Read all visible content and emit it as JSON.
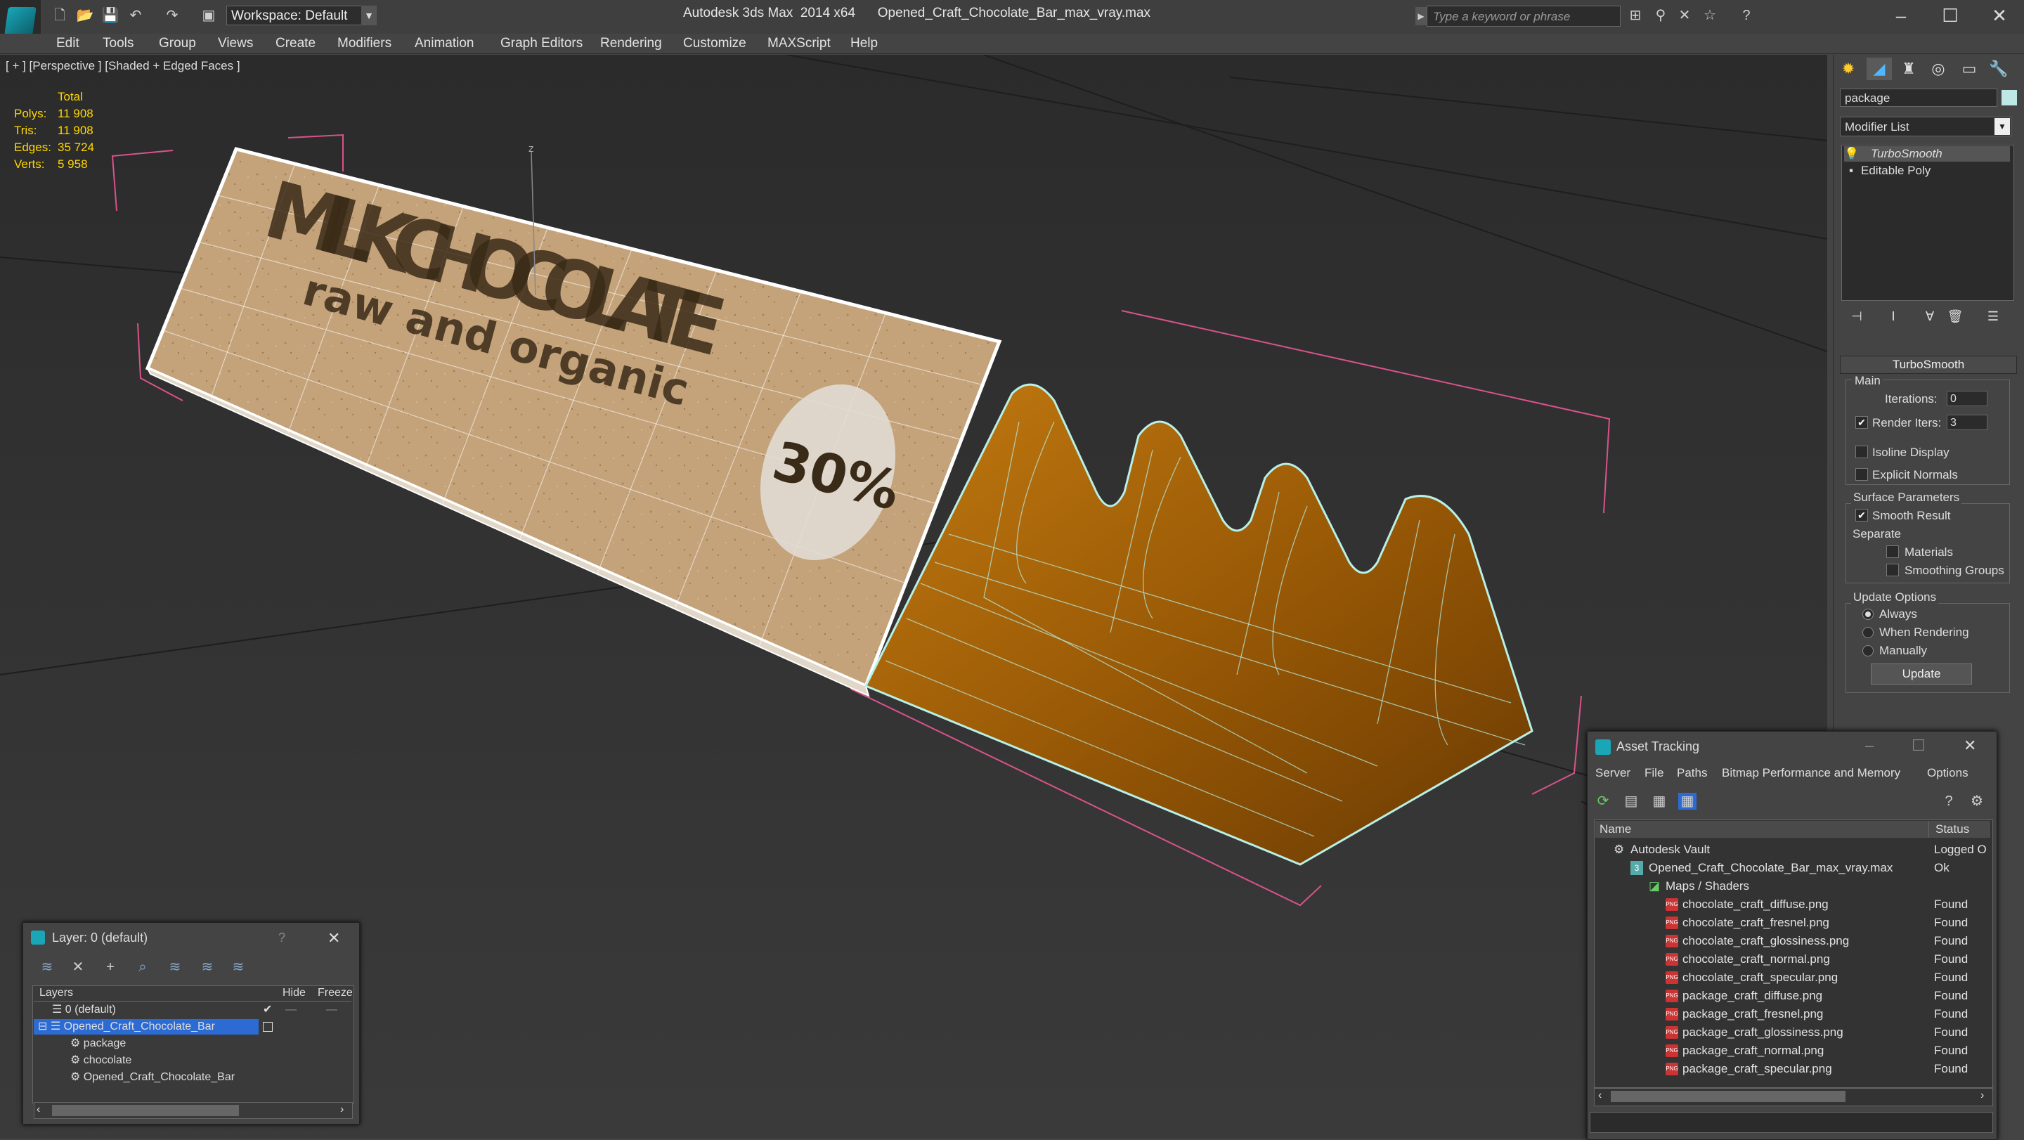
{
  "titlebar": {
    "workspace": "Workspace: Default",
    "app_title": "Autodesk 3ds Max  2014 x64",
    "file_title": "Opened_Craft_Chocolate_Bar_max_vray.max",
    "search_placeholder": "Type a keyword or phrase"
  },
  "menu": [
    "Edit",
    "Tools",
    "Group",
    "Views",
    "Create",
    "Modifiers",
    "Animation",
    "Graph Editors",
    "Rendering",
    "Customize",
    "MAXScript",
    "Help"
  ],
  "viewport": {
    "label": "[ + ] [Perspective ] [Shaded + Edged Faces ]",
    "stats_header": "Total",
    "stats": [
      {
        "label": "Polys:",
        "value": "11 908"
      },
      {
        "label": "Tris:",
        "value": "11 908"
      },
      {
        "label": "Edges:",
        "value": "35 724"
      },
      {
        "label": "Verts:",
        "value": "5 958"
      }
    ],
    "package_title": "MILK CHOCOLATE",
    "package_subtitle": "raw and organic",
    "package_badge": "30%"
  },
  "command_panel": {
    "object_name": "package",
    "object_color": "#bde8e6",
    "modifier_list": "Modifier List",
    "stack": [
      "TurboSmooth",
      "Editable Poly"
    ],
    "rollout_title": "TurboSmooth",
    "main_group": "Main",
    "iterations_label": "Iterations:",
    "iterations_value": "0",
    "render_iters_label": "Render Iters:",
    "render_iters_value": "3",
    "isoline": "Isoline Display",
    "explicit_normals": "Explicit Normals",
    "surface_group": "Surface Parameters",
    "smooth_result": "Smooth Result",
    "separate": "Separate",
    "materials": "Materials",
    "smoothing_groups": "Smoothing Groups",
    "update_group": "Update Options",
    "always": "Always",
    "when_rendering": "When Rendering",
    "manually": "Manually",
    "update_button": "Update"
  },
  "layer_dialog": {
    "title": "Layer: 0 (default)",
    "help": "?",
    "col_layers": "Layers",
    "col_hide": "Hide",
    "col_freeze": "Freeze",
    "rows": [
      "0 (default)",
      "Opened_Craft_Chocolate_Bar",
      "package",
      "chocolate",
      "Opened_Craft_Chocolate_Bar"
    ]
  },
  "asset_tracking": {
    "title": "Asset Tracking",
    "menu": [
      "Server",
      "File",
      "Paths",
      "Bitmap Performance and Memory",
      "Options"
    ],
    "col_name": "Name",
    "col_status": "Status",
    "rows": [
      {
        "name": "Autodesk Vault",
        "status": "Logged O"
      },
      {
        "name": "Opened_Craft_Chocolate_Bar_max_vray.max",
        "status": "Ok"
      },
      {
        "name": "Maps / Shaders",
        "status": ""
      },
      {
        "name": "chocolate_craft_diffuse.png",
        "status": "Found"
      },
      {
        "name": "chocolate_craft_fresnel.png",
        "status": "Found"
      },
      {
        "name": "chocolate_craft_glossiness.png",
        "status": "Found"
      },
      {
        "name": "chocolate_craft_normal.png",
        "status": "Found"
      },
      {
        "name": "chocolate_craft_specular.png",
        "status": "Found"
      },
      {
        "name": "package_craft_diffuse.png",
        "status": "Found"
      },
      {
        "name": "package_craft_fresnel.png",
        "status": "Found"
      },
      {
        "name": "package_craft_glossiness.png",
        "status": "Found"
      },
      {
        "name": "package_craft_normal.png",
        "status": "Found"
      },
      {
        "name": "package_craft_specular.png",
        "status": "Found"
      }
    ],
    "png_label": "PNG"
  }
}
